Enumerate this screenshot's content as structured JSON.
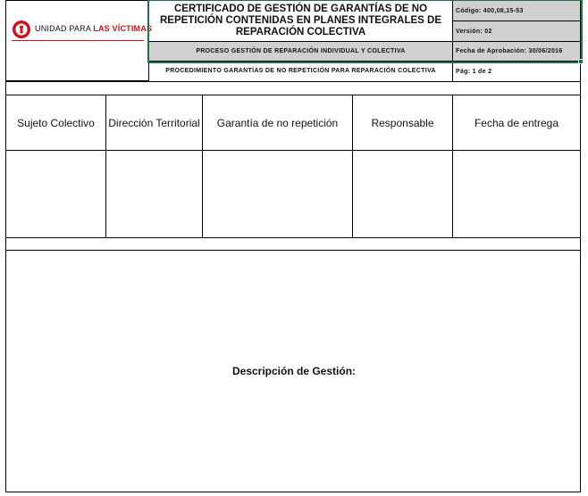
{
  "header": {
    "logo_text_a": "UNIDAD PARA ",
    "logo_text_b": "LAS VÍCTIMAS",
    "title": "CERTIFICADO DE GESTIÓN DE GARANTÍAS DE NO REPETICIÓN CONTENIDAS EN PLANES INTEGRALES DE REPARACIÓN COLECTIVA",
    "process": "PROCESO GESTIÓN DE REPARACIÓN INDIVIDUAL Y COLECTIVA",
    "procedure": "PROCEDIMIENTO GARANTÍAS DE NO REPETICIÓN PARA REPARACIÓN COLECTIVA",
    "code": "Código: 400,08,15-53",
    "version": "Versión: 02",
    "approval_date": "Fecha de Aprobación: 30/06/2016",
    "page": "Pág: 1 de 2"
  },
  "table": {
    "columns": [
      "Sujeto Colectivo",
      "Dirección Territorial",
      "Garantía de no repetición",
      "Responsable",
      "Fecha de entrega"
    ]
  },
  "description_label": "Descripción de Gestión:",
  "colors": {
    "selection": "#217346",
    "header_gray": "#d0d0d0",
    "logo_red": "#c4161c"
  }
}
